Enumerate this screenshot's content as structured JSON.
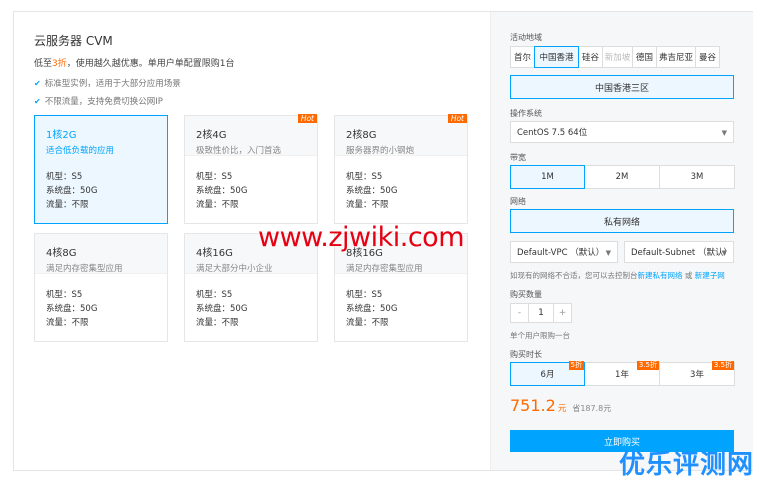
{
  "product": {
    "title": "云服务器 CVM",
    "promo_pre": "低至",
    "promo_highlight": "3折",
    "promo_post": "，使用越久越优惠。单用户单配置限购1台",
    "features": [
      "标准型实例，适用于大部分应用场景",
      "不限流量，支持免费切换公网IP"
    ]
  },
  "cards": [
    {
      "name": "1核2G",
      "desc": "适合低负载的应用",
      "model": "机型：S5",
      "disk": "系统盘：50G",
      "traffic": "流量：不限",
      "hot": "",
      "selected": true
    },
    {
      "name": "2核4G",
      "desc": "极致性价比，入门首选",
      "model": "机型：S5",
      "disk": "系统盘：50G",
      "traffic": "流量：不限",
      "hot": "Hot",
      "selected": false
    },
    {
      "name": "2核8G",
      "desc": "服务器界的小钢炮",
      "model": "机型：S5",
      "disk": "系统盘：50G",
      "traffic": "流量：不限",
      "hot": "Hot",
      "selected": false
    },
    {
      "name": "4核8G",
      "desc": "满足内存密集型应用",
      "model": "机型：S5",
      "disk": "系统盘：50G",
      "traffic": "流量：不限",
      "hot": "",
      "selected": false
    },
    {
      "name": "4核16G",
      "desc": "满足大部分中小企业",
      "model": "机型：S5",
      "disk": "系统盘：50G",
      "traffic": "流量：不限",
      "hot": "",
      "selected": false
    },
    {
      "name": "8核16G",
      "desc": "满足内存密集型应用",
      "model": "机型：S5",
      "disk": "系统盘：50G",
      "traffic": "流量：不限",
      "hot": "",
      "selected": false
    }
  ],
  "config": {
    "region_label": "活动地域",
    "regions": [
      {
        "label": "首尔",
        "state": "normal"
      },
      {
        "label": "中国香港",
        "state": "active"
      },
      {
        "label": "硅谷",
        "state": "normal"
      },
      {
        "label": "新加坡",
        "state": "disabled"
      },
      {
        "label": "德国",
        "state": "normal"
      },
      {
        "label": "弗吉尼亚",
        "state": "normal"
      },
      {
        "label": "曼谷",
        "state": "normal"
      }
    ],
    "zone": "中国香港三区",
    "os_label": "操作系统",
    "os_value": "CentOS 7.5 64位",
    "bandwidth_label": "带宽",
    "bandwidths": [
      {
        "label": "1M",
        "state": "active"
      },
      {
        "label": "2M",
        "state": "normal"
      },
      {
        "label": "3M",
        "state": "normal"
      }
    ],
    "network_label": "网络",
    "network_value": "私有网络",
    "vpc_value": "Default-VPC （默认）",
    "subnet_value": "Default-Subnet （默认）",
    "network_note_pre": "如现有的网络不合适，您可以去控制台",
    "network_link1": "新建私有网络",
    "network_note_mid": " 或 ",
    "network_link2": "新建子网",
    "quantity_label": "购买数量",
    "quantity_minus": "-",
    "quantity_value": "1",
    "quantity_plus": "+",
    "quantity_note": "单个用户限购一台",
    "duration_label": "购买时长",
    "durations": [
      {
        "label": "6月",
        "tag": "5折",
        "state": "active"
      },
      {
        "label": "1年",
        "tag": "3.5折",
        "state": "normal"
      },
      {
        "label": "3年",
        "tag": "3.5折",
        "state": "normal"
      }
    ],
    "price": "751.2",
    "price_unit": "元",
    "saving": "省187.8元",
    "buy_label": "立即购买"
  },
  "watermark": "www.zjwiki.com",
  "brand": "优乐评测网",
  "colors": {
    "accent": "#00a4ff",
    "orange": "#ff6a00",
    "watermark": "#e60012",
    "brand": "#1e90ff"
  }
}
